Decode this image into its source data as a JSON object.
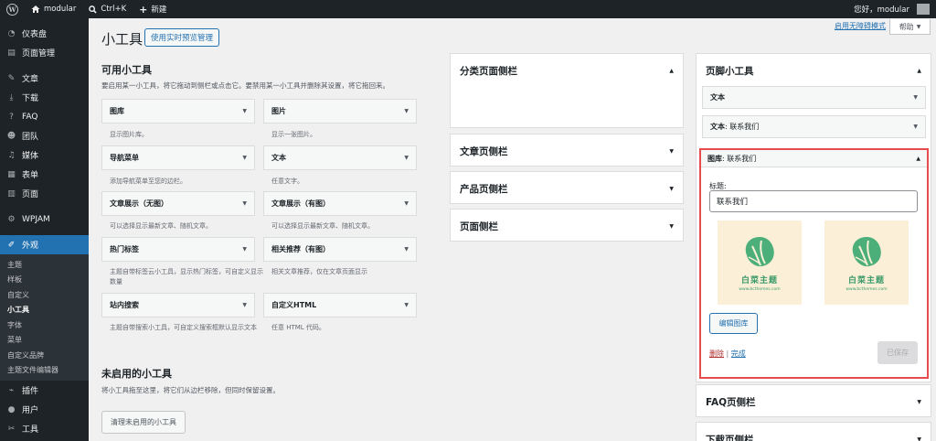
{
  "adminbar": {
    "site_name": "modular",
    "shortcut": "Ctrl+K",
    "new_label": "新建",
    "greeting": "您好，modular"
  },
  "sidebar": {
    "items": [
      {
        "label": "仪表盘",
        "icon": "dashboard-icon"
      },
      {
        "label": "页面管理",
        "icon": "page-manage-icon"
      },
      {
        "label": "文章",
        "icon": "pin-icon"
      },
      {
        "label": "下载",
        "icon": "download-icon"
      },
      {
        "label": "FAQ",
        "icon": "question-icon"
      },
      {
        "label": "团队",
        "icon": "group-icon"
      },
      {
        "label": "媒体",
        "icon": "media-icon"
      },
      {
        "label": "表单",
        "icon": "form-icon"
      },
      {
        "label": "页面",
        "icon": "page-icon"
      },
      {
        "label": "WPJAM",
        "icon": "gear-icon"
      },
      {
        "label": "外观",
        "icon": "brush-icon"
      },
      {
        "label": "插件",
        "icon": "plugin-icon"
      },
      {
        "label": "用户",
        "icon": "user-icon"
      },
      {
        "label": "工具",
        "icon": "wrench-icon"
      }
    ],
    "submenu": [
      "主题",
      "样板",
      "自定义",
      "小工具",
      "字体",
      "菜单",
      "自定义品牌",
      "主题文件编辑器"
    ]
  },
  "screen_meta": {
    "a11y_link": "启用无障碍模式",
    "help": "帮助"
  },
  "page": {
    "title": "小工具",
    "live_preview_button": "使用实时预览管理"
  },
  "available": {
    "heading": "可用小工具",
    "description": "要启用某一小工具，将它拖动到侧栏或点击它。要禁用某一小工具并删除其设置，将它拖回来。",
    "widgets": [
      {
        "name": "图库",
        "desc": "显示图片库。"
      },
      {
        "name": "图片",
        "desc": "显示一张图片。"
      },
      {
        "name": "导航菜单",
        "desc": "添加导航菜单至您的边栏。"
      },
      {
        "name": "文本",
        "desc": "任意文字。"
      },
      {
        "name": "文章展示（无图）",
        "desc": "可以选择显示最新文章、随机文章。"
      },
      {
        "name": "文章展示（有图）",
        "desc": "可以选择显示最新文章、随机文章。"
      },
      {
        "name": "热门标签",
        "desc": "主题自带标签云小工具，显示热门标签，可自定义显示数量"
      },
      {
        "name": "相关推荐（有图）",
        "desc": "相关文章推荐，仅在文章页面显示"
      },
      {
        "name": "站内搜索",
        "desc": "主题自带搜索小工具，可自定义搜索框默认显示文本"
      },
      {
        "name": "自定义HTML",
        "desc": "任意 HTML 代码。"
      }
    ]
  },
  "inactive": {
    "heading": "未启用的小工具",
    "description": "将小工具拖至这里，将它们从边栏移除，但同时保留设置。",
    "clear_button": "清理未启用的小工具"
  },
  "middle_sidebars": [
    "分类页面侧栏",
    "文章页侧栏",
    "产品页侧栏",
    "页面侧栏"
  ],
  "footer_sidebar": {
    "title": "页脚小工具",
    "widgets": [
      {
        "name": "文本",
        "sub": ""
      },
      {
        "name": "文本",
        "sub": ": 联系我们"
      }
    ],
    "gallery": {
      "header": "图库",
      "header_sub": ": 联系我们",
      "title_label": "标题:",
      "title_value": "联系我们",
      "image_brand": "白菜主题",
      "image_url": "www.bcthemes.com",
      "edit_button": "编辑图库",
      "delete": "删除",
      "separator": "|",
      "done": "完成",
      "saved": "已保存"
    }
  },
  "lower_sidebars": [
    "FAQ页侧栏",
    "下载页侧栏"
  ],
  "colors": {
    "accent": "#2271b1",
    "admin_dark": "#1d2327",
    "highlight_border": "#e74c4c",
    "brand_green": "#3c9a6b",
    "thumb_bg": "#fbf0d7"
  }
}
